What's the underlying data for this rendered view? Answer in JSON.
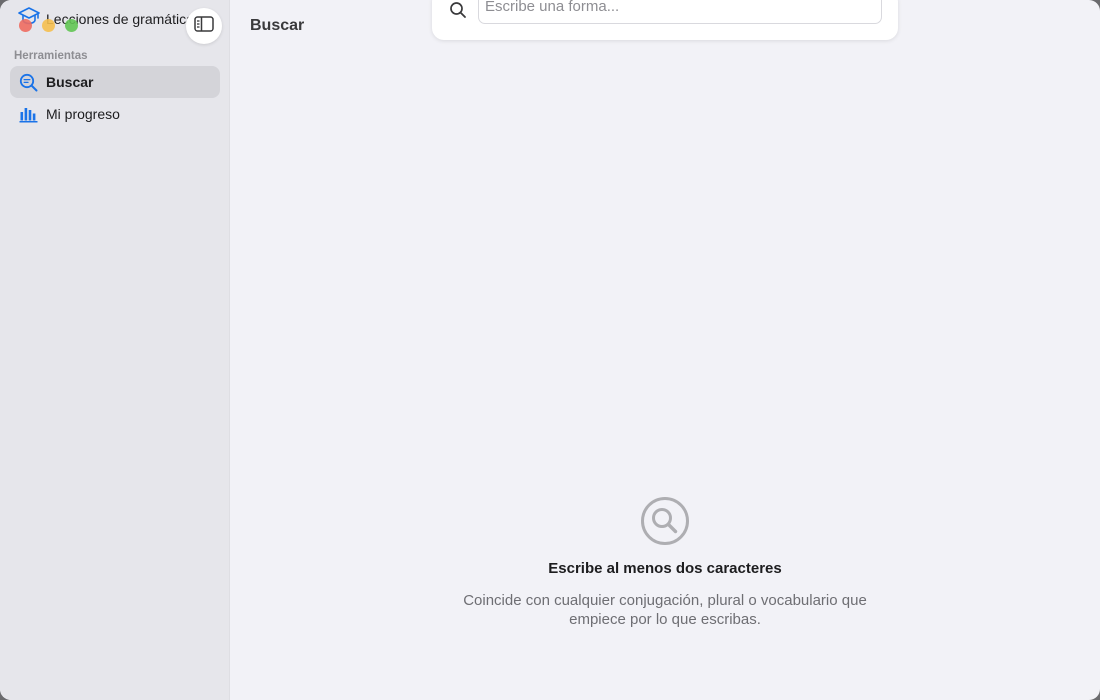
{
  "app": {
    "title": "Lecciones de gramática"
  },
  "colors": {
    "accent": "#1a73e8",
    "sidebar_bg": "#e6e6eb",
    "content_bg": "#f2f2f7"
  },
  "sidebar": {
    "section_label": "Herramientas",
    "items": [
      {
        "label": "Buscar",
        "icon": "search-document-icon",
        "active": true
      },
      {
        "label": "Mi progreso",
        "icon": "bar-chart-icon",
        "active": false
      }
    ]
  },
  "main": {
    "title": "Buscar",
    "search": {
      "value": "",
      "placeholder": "Escribe una forma..."
    },
    "empty_state": {
      "icon": "magnifying-glass-icon",
      "title": "Escribe al menos dos caracteres",
      "subtitle": "Coincide con cualquier conjugación, plural o vocabulario que empiece por lo que escribas."
    }
  }
}
